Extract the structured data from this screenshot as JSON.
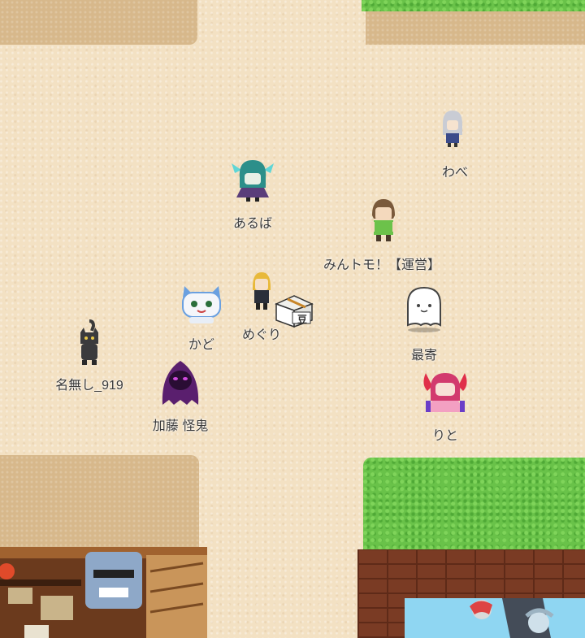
{
  "players": [
    {
      "key": "wabe",
      "name": "わべ"
    },
    {
      "key": "aruba",
      "name": "あるば"
    },
    {
      "key": "mintomo",
      "name": "みんトモ！【運営】"
    },
    {
      "key": "kado",
      "name": "かど"
    },
    {
      "key": "megu",
      "name": "めぐり"
    },
    {
      "key": "nanashi",
      "name": "名無し_919"
    },
    {
      "key": "katou",
      "name": "加藤 怪鬼"
    },
    {
      "key": "mogiri",
      "name": "最寄"
    },
    {
      "key": "rito",
      "name": "りと"
    }
  ],
  "bean_box_label": "豆",
  "colors": {
    "sand": "#f3e1c3",
    "dirt": "#d7b88b",
    "grass": "#69c249",
    "brick": "#7a3b24",
    "name_text": "#3a3a3a"
  }
}
